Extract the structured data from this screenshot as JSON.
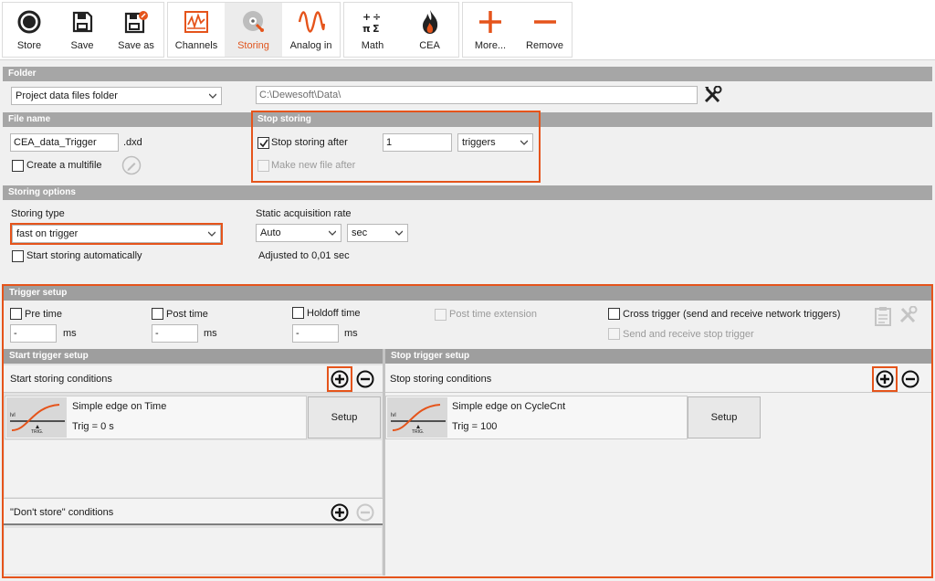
{
  "toolbar": {
    "store": "Store",
    "save": "Save",
    "save_as": "Save as",
    "channels": "Channels",
    "storing": "Storing",
    "analog_in": "Analog in",
    "math": "Math",
    "cea": "CEA",
    "more": "More...",
    "remove": "Remove"
  },
  "folder": {
    "header": "Folder",
    "select_value": "Project data files folder",
    "path": "C:\\Dewesoft\\Data\\"
  },
  "file_name": {
    "header": "File name",
    "value": "CEA_data_Trigger",
    "ext": ".dxd",
    "multifile_label": "Create a multifile"
  },
  "stop_storing": {
    "header": "Stop storing",
    "after_label": "Stop storing after",
    "after_value": "1",
    "unit": "triggers",
    "new_file_label": "Make new file after"
  },
  "storing_options": {
    "header": "Storing options",
    "type_label": "Storing type",
    "type_value": "fast on trigger",
    "auto_label": "Start storing automatically",
    "rate_label": "Static acquisition rate",
    "rate_value": "Auto",
    "rate_unit": "sec",
    "adjusted": "Adjusted to 0,01 sec"
  },
  "trigger_setup": {
    "header": "Trigger setup",
    "pre_time": "Pre time",
    "post_time": "Post time",
    "holdoff_time": "Holdoff time",
    "post_ext": "Post time extension",
    "cross_trigger": "Cross trigger (send and receive network triggers)",
    "send_receive_stop": "Send and receive stop trigger",
    "pre_value": "-",
    "post_value": "-",
    "holdoff_value": "-",
    "unit": "ms"
  },
  "start_trigger": {
    "header": "Start trigger setup",
    "conditions_label": "Start storing conditions",
    "item_name": "Simple edge on Time",
    "item_value": "Trig = 0 s",
    "setup_label": "Setup",
    "dont_store_label": "\"Don't store\" conditions",
    "thumb_level": "lvl",
    "thumb_trig": "TRIG."
  },
  "stop_trigger": {
    "header": "Stop trigger setup",
    "conditions_label": "Stop storing conditions",
    "item_name": "Simple edge on CycleCnt",
    "item_value": "Trig = 100",
    "setup_label": "Setup",
    "thumb_level": "lvl",
    "thumb_trig": "TRIG."
  },
  "colors": {
    "accent": "#e5541b",
    "header_gray": "#a6a6a6"
  }
}
